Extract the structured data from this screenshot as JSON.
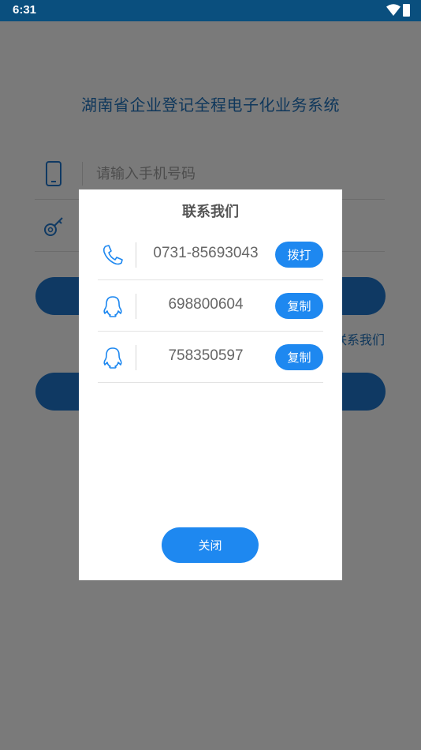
{
  "status_bar": {
    "time": "6:31"
  },
  "app": {
    "title": "湖南省企业登记全程电子化业务系统"
  },
  "login": {
    "phone_placeholder": "请输入手机号码",
    "phone_value": "",
    "password_placeholder": "",
    "contact_link": "联系我们"
  },
  "dialog": {
    "title": "联系我们",
    "items": [
      {
        "icon": "phone-icon",
        "value": "0731-85693043",
        "action": "拨打"
      },
      {
        "icon": "qq-icon",
        "value": "698800604",
        "action": "复制"
      },
      {
        "icon": "qq-icon",
        "value": "758350597",
        "action": "复制"
      }
    ],
    "close_label": "关闭"
  },
  "colors": {
    "status_bar": "#0a4f7e",
    "brand_blue": "#1e73c7",
    "dialog_button": "#1e88f0",
    "title_text": "#1f6fb7"
  }
}
